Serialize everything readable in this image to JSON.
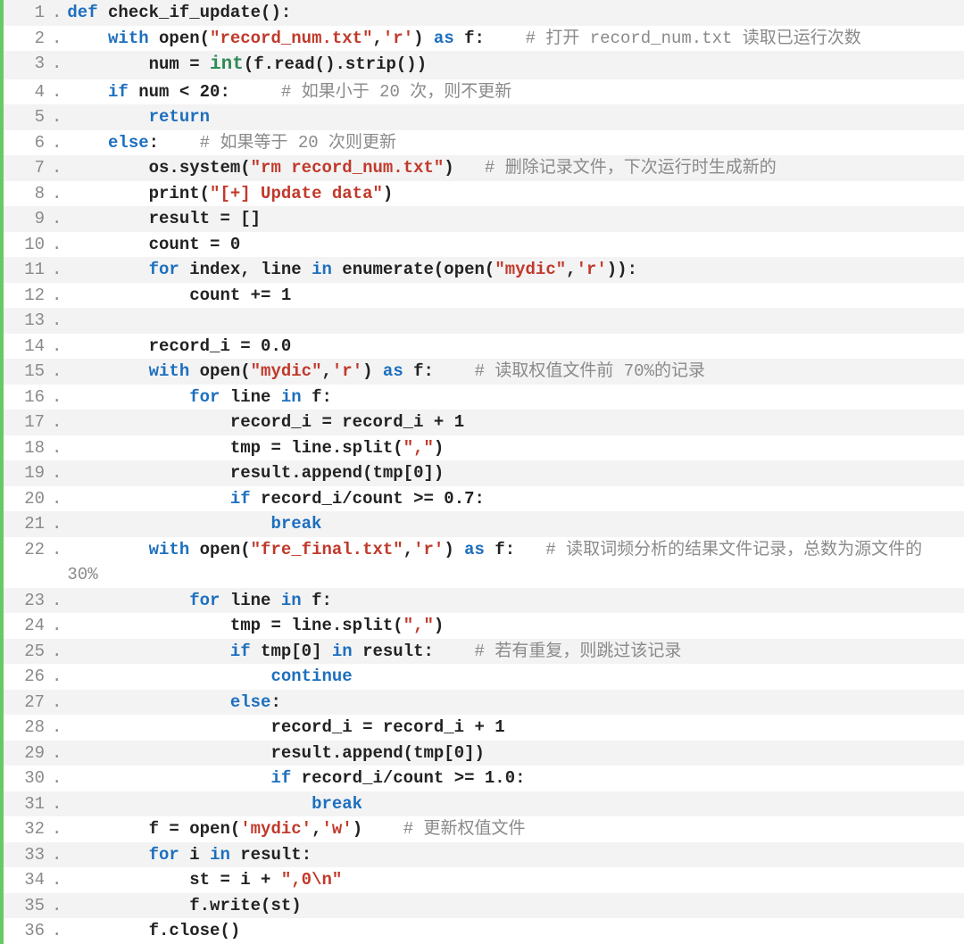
{
  "lines": [
    {
      "n": "1",
      "tokens": [
        {
          "t": "kw",
          "v": "def"
        },
        {
          "t": "pl",
          "v": " check_if_update():"
        }
      ]
    },
    {
      "n": "2",
      "tokens": [
        {
          "t": "pl",
          "v": "    "
        },
        {
          "t": "kw",
          "v": "with"
        },
        {
          "t": "pl",
          "v": " open("
        },
        {
          "t": "str",
          "v": "\"record_num.txt\""
        },
        {
          "t": "pl",
          "v": ","
        },
        {
          "t": "str",
          "v": "'r'"
        },
        {
          "t": "pl",
          "v": ") "
        },
        {
          "t": "kw",
          "v": "as"
        },
        {
          "t": "pl",
          "v": " f:    "
        },
        {
          "t": "cmt",
          "v": "# 打开 record_num.txt 读取已运行次数"
        }
      ]
    },
    {
      "n": "3",
      "tokens": [
        {
          "t": "pl",
          "v": "        num = "
        },
        {
          "t": "fn",
          "v": "int"
        },
        {
          "t": "pl",
          "v": "(f.read().strip())"
        }
      ]
    },
    {
      "n": "4",
      "tokens": [
        {
          "t": "pl",
          "v": "    "
        },
        {
          "t": "kw",
          "v": "if"
        },
        {
          "t": "pl",
          "v": " num < "
        },
        {
          "t": "num",
          "v": "20"
        },
        {
          "t": "pl",
          "v": ":     "
        },
        {
          "t": "cmt",
          "v": "# 如果小于 20 次，则不更新"
        }
      ]
    },
    {
      "n": "5",
      "tokens": [
        {
          "t": "pl",
          "v": "        "
        },
        {
          "t": "kw",
          "v": "return"
        }
      ]
    },
    {
      "n": "6",
      "tokens": [
        {
          "t": "pl",
          "v": "    "
        },
        {
          "t": "kw",
          "v": "else"
        },
        {
          "t": "pl",
          "v": ":    "
        },
        {
          "t": "cmt",
          "v": "# 如果等于 20 次则更新"
        }
      ]
    },
    {
      "n": "7",
      "tokens": [
        {
          "t": "pl",
          "v": "        os.system("
        },
        {
          "t": "str",
          "v": "\"rm record_num.txt\""
        },
        {
          "t": "pl",
          "v": ")   "
        },
        {
          "t": "cmt",
          "v": "# 删除记录文件，下次运行时生成新的"
        }
      ]
    },
    {
      "n": "8",
      "tokens": [
        {
          "t": "pl",
          "v": "        print("
        },
        {
          "t": "str",
          "v": "\"[+] Update data\""
        },
        {
          "t": "pl",
          "v": ")"
        }
      ]
    },
    {
      "n": "9",
      "tokens": [
        {
          "t": "pl",
          "v": "        result = []"
        }
      ]
    },
    {
      "n": "10",
      "tokens": [
        {
          "t": "pl",
          "v": "        count = "
        },
        {
          "t": "num",
          "v": "0"
        }
      ]
    },
    {
      "n": "11",
      "tokens": [
        {
          "t": "pl",
          "v": "        "
        },
        {
          "t": "kw",
          "v": "for"
        },
        {
          "t": "pl",
          "v": " index, line "
        },
        {
          "t": "kw",
          "v": "in"
        },
        {
          "t": "pl",
          "v": " enumerate(open("
        },
        {
          "t": "str",
          "v": "\"mydic\""
        },
        {
          "t": "pl",
          "v": ","
        },
        {
          "t": "str",
          "v": "'r'"
        },
        {
          "t": "pl",
          "v": ")):"
        }
      ]
    },
    {
      "n": "12",
      "tokens": [
        {
          "t": "pl",
          "v": "            count += "
        },
        {
          "t": "num",
          "v": "1"
        }
      ]
    },
    {
      "n": "13",
      "tokens": [
        {
          "t": "pl",
          "v": " "
        }
      ]
    },
    {
      "n": "14",
      "tokens": [
        {
          "t": "pl",
          "v": "        record_i = "
        },
        {
          "t": "num",
          "v": "0.0"
        }
      ]
    },
    {
      "n": "15",
      "tokens": [
        {
          "t": "pl",
          "v": "        "
        },
        {
          "t": "kw",
          "v": "with"
        },
        {
          "t": "pl",
          "v": " open("
        },
        {
          "t": "str",
          "v": "\"mydic\""
        },
        {
          "t": "pl",
          "v": ","
        },
        {
          "t": "str",
          "v": "'r'"
        },
        {
          "t": "pl",
          "v": ") "
        },
        {
          "t": "kw",
          "v": "as"
        },
        {
          "t": "pl",
          "v": " f:    "
        },
        {
          "t": "cmt",
          "v": "# 读取权值文件前 70%的记录"
        }
      ]
    },
    {
      "n": "16",
      "tokens": [
        {
          "t": "pl",
          "v": "            "
        },
        {
          "t": "kw",
          "v": "for"
        },
        {
          "t": "pl",
          "v": " line "
        },
        {
          "t": "kw",
          "v": "in"
        },
        {
          "t": "pl",
          "v": " f:"
        }
      ]
    },
    {
      "n": "17",
      "tokens": [
        {
          "t": "pl",
          "v": "                record_i = record_i + "
        },
        {
          "t": "num",
          "v": "1"
        }
      ]
    },
    {
      "n": "18",
      "tokens": [
        {
          "t": "pl",
          "v": "                tmp = line.split("
        },
        {
          "t": "str",
          "v": "\",\""
        },
        {
          "t": "pl",
          "v": ")"
        }
      ]
    },
    {
      "n": "19",
      "tokens": [
        {
          "t": "pl",
          "v": "                result.append(tmp["
        },
        {
          "t": "num",
          "v": "0"
        },
        {
          "t": "pl",
          "v": "])"
        }
      ]
    },
    {
      "n": "20",
      "tokens": [
        {
          "t": "pl",
          "v": "                "
        },
        {
          "t": "kw",
          "v": "if"
        },
        {
          "t": "pl",
          "v": " record_i/count >= "
        },
        {
          "t": "num",
          "v": "0.7"
        },
        {
          "t": "pl",
          "v": ":"
        }
      ]
    },
    {
      "n": "21",
      "tokens": [
        {
          "t": "pl",
          "v": "                    "
        },
        {
          "t": "kw",
          "v": "break"
        }
      ]
    },
    {
      "n": "22",
      "tokens": [
        {
          "t": "pl",
          "v": "        "
        },
        {
          "t": "kw",
          "v": "with"
        },
        {
          "t": "pl",
          "v": " open("
        },
        {
          "t": "str",
          "v": "\"fre_final.txt\""
        },
        {
          "t": "pl",
          "v": ","
        },
        {
          "t": "str",
          "v": "'r'"
        },
        {
          "t": "pl",
          "v": ") "
        },
        {
          "t": "kw",
          "v": "as"
        },
        {
          "t": "pl",
          "v": " f:   "
        },
        {
          "t": "cmt",
          "v": "# 读取词频分析的结果文件记录，总数为源文件的 30%"
        }
      ]
    },
    {
      "n": "23",
      "tokens": [
        {
          "t": "pl",
          "v": "            "
        },
        {
          "t": "kw",
          "v": "for"
        },
        {
          "t": "pl",
          "v": " line "
        },
        {
          "t": "kw",
          "v": "in"
        },
        {
          "t": "pl",
          "v": " f:"
        }
      ]
    },
    {
      "n": "24",
      "tokens": [
        {
          "t": "pl",
          "v": "                tmp = line.split("
        },
        {
          "t": "str",
          "v": "\",\""
        },
        {
          "t": "pl",
          "v": ")"
        }
      ]
    },
    {
      "n": "25",
      "tokens": [
        {
          "t": "pl",
          "v": "                "
        },
        {
          "t": "kw",
          "v": "if"
        },
        {
          "t": "pl",
          "v": " tmp["
        },
        {
          "t": "num",
          "v": "0"
        },
        {
          "t": "pl",
          "v": "] "
        },
        {
          "t": "kw",
          "v": "in"
        },
        {
          "t": "pl",
          "v": " result:    "
        },
        {
          "t": "cmt",
          "v": "# 若有重复，则跳过该记录"
        }
      ]
    },
    {
      "n": "26",
      "tokens": [
        {
          "t": "pl",
          "v": "                    "
        },
        {
          "t": "kw",
          "v": "continue"
        }
      ]
    },
    {
      "n": "27",
      "tokens": [
        {
          "t": "pl",
          "v": "                "
        },
        {
          "t": "kw",
          "v": "else"
        },
        {
          "t": "pl",
          "v": ":"
        }
      ]
    },
    {
      "n": "28",
      "tokens": [
        {
          "t": "pl",
          "v": "                    record_i = record_i + "
        },
        {
          "t": "num",
          "v": "1"
        }
      ]
    },
    {
      "n": "29",
      "tokens": [
        {
          "t": "pl",
          "v": "                    result.append(tmp["
        },
        {
          "t": "num",
          "v": "0"
        },
        {
          "t": "pl",
          "v": "])"
        }
      ]
    },
    {
      "n": "30",
      "tokens": [
        {
          "t": "pl",
          "v": "                    "
        },
        {
          "t": "kw",
          "v": "if"
        },
        {
          "t": "pl",
          "v": " record_i/count >= "
        },
        {
          "t": "num",
          "v": "1.0"
        },
        {
          "t": "pl",
          "v": ":"
        }
      ]
    },
    {
      "n": "31",
      "tokens": [
        {
          "t": "pl",
          "v": "                        "
        },
        {
          "t": "kw",
          "v": "break"
        }
      ]
    },
    {
      "n": "32",
      "tokens": [
        {
          "t": "pl",
          "v": "        f = open("
        },
        {
          "t": "str",
          "v": "'mydic'"
        },
        {
          "t": "pl",
          "v": ","
        },
        {
          "t": "str",
          "v": "'w'"
        },
        {
          "t": "pl",
          "v": ")    "
        },
        {
          "t": "cmt",
          "v": "# 更新权值文件"
        }
      ]
    },
    {
      "n": "33",
      "tokens": [
        {
          "t": "pl",
          "v": "        "
        },
        {
          "t": "kw",
          "v": "for"
        },
        {
          "t": "pl",
          "v": " i "
        },
        {
          "t": "kw",
          "v": "in"
        },
        {
          "t": "pl",
          "v": " result:"
        }
      ]
    },
    {
      "n": "34",
      "tokens": [
        {
          "t": "pl",
          "v": "            st = i + "
        },
        {
          "t": "str",
          "v": "\",0\\n\""
        }
      ]
    },
    {
      "n": "35",
      "tokens": [
        {
          "t": "pl",
          "v": "            f.write(st)"
        }
      ]
    },
    {
      "n": "36",
      "tokens": [
        {
          "t": "pl",
          "v": "        f.close()"
        }
      ]
    }
  ]
}
